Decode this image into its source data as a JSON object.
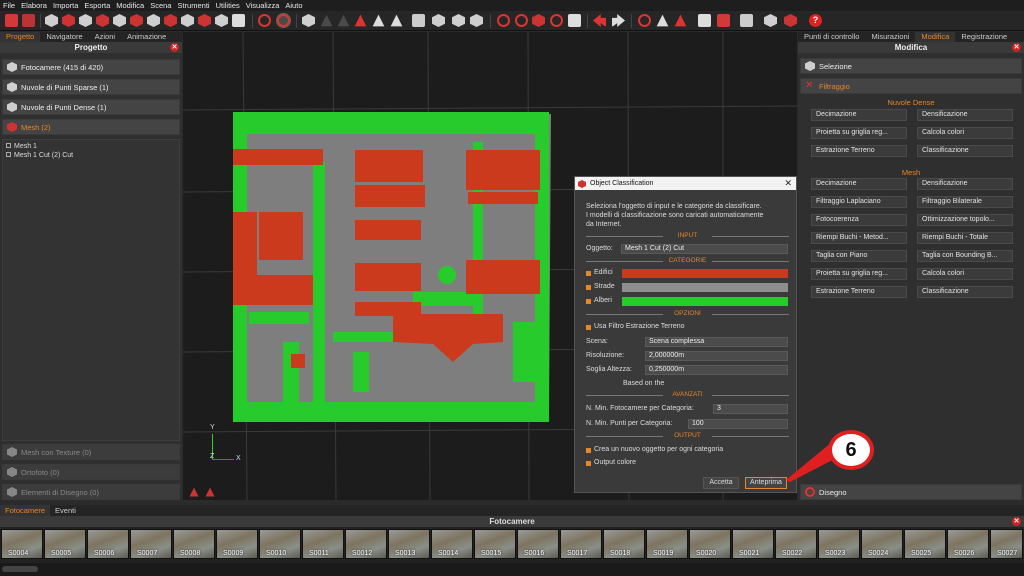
{
  "menu": [
    "File",
    "Elabora",
    "Importa",
    "Esporta",
    "Modifica",
    "Scena",
    "Strumenti",
    "Utilities",
    "Visualizza",
    "Aiuto"
  ],
  "left_panel": {
    "tabs": [
      "Progetto",
      "Navigatore",
      "Azioni",
      "Animazione"
    ],
    "title": "Progetto",
    "groups": [
      "Fotocamere (415 di 420)",
      "Nuvole di Punti Sparse (1)",
      "Nuvole di Punti Dense (1)",
      "Mesh (2)"
    ],
    "tree": [
      "Mesh 1",
      "Mesh 1 Cut (2) Cut"
    ],
    "bottom_groups": [
      "Mesh con Texture (0)",
      "Ortofoto (0)",
      "Elementi di Disegno (0)"
    ]
  },
  "right_panel": {
    "tabs": [
      "Punti di controllo",
      "Misurazioni",
      "Modifica",
      "Registrazione"
    ],
    "title": "Modifica",
    "selezione": "Selezione",
    "filtraggio": "Filtraggio",
    "nuvole_dense_header": "Nuvole Dense",
    "nuvole_dense_buttons": [
      "Decimazione",
      "Densificazione",
      "Proietta su griglia reg...",
      "Calcola colori",
      "Estrazione Terreno",
      "Classificazione"
    ],
    "mesh_header": "Mesh",
    "mesh_buttons": [
      "Decimazione",
      "Densificazione",
      "Filtraggio Laplaciano",
      "Filtraggio Bilaterale",
      "Fotocoerenza",
      "Ottimizzazione topolo...",
      "Riempi Buchi - Metod...",
      "Riempi Buchi - Totale",
      "Taglia con Piano",
      "Taglia con Bounding B...",
      "Proietta su griglia reg...",
      "Calcola colori",
      "Estrazione Terreno",
      "Classificazione"
    ],
    "disegno": "Disegno"
  },
  "dialog": {
    "title": "Object Classification",
    "intro": [
      "Seleziona l'oggetto di input e le categorie da classificare.",
      "I modelli di classificazione sono caricati automaticamente",
      "da Internet."
    ],
    "sec_input": "INPUT",
    "oggetto_label": "Oggetto:",
    "oggetto_value": "Mesh 1 Cut (2) Cut",
    "sec_categorie": "CATEGORIE",
    "categories": [
      {
        "name": "Edifici",
        "color": "#cc3a1e"
      },
      {
        "name": "Strade",
        "color": "#8e8e8e"
      },
      {
        "name": "Alberi",
        "color": "#27cc2c"
      }
    ],
    "sec_opzioni": "OPZIONI",
    "usa_filtro": "Usa Filtro Estrazione Terreno",
    "scena_label": "Scena:",
    "scena_value": "Scena complessa",
    "risoluzione_label": "Risoluzione:",
    "risoluzione_value": "2,000000m",
    "soglia_label": "Soglia Altezza:",
    "soglia_value": "0,250000m",
    "based_on": "Based on the",
    "sec_avanzati": "AVANZATI",
    "min_foto_label": "N. Min. Fotocamere per Categoria:",
    "min_foto_value": "3",
    "min_punti_label": "N. Min. Punti per Categoria:",
    "min_punti_value": "100",
    "sec_output": "OUTPUT",
    "crea_oggetto": "Crea un nuovo oggetto per ogni categoria",
    "output_colore": "Output colore",
    "accetta": "Accetta",
    "anteprima": "Anteprima"
  },
  "callout": "6",
  "axes": {
    "y": "Y",
    "x": "X",
    "z": "Z"
  },
  "bottom": {
    "tabs": [
      "Fotocamere",
      "Eventi"
    ],
    "title": "Fotocamere",
    "thumbs": [
      "S0004",
      "S0005",
      "S0006",
      "S0007",
      "S0008",
      "S0009",
      "S0010",
      "S0011",
      "S0012",
      "S0013",
      "S0014",
      "S0015",
      "S0016",
      "S0017",
      "S0018",
      "S0019",
      "S0020",
      "S0021",
      "S0022",
      "S0023",
      "S0024",
      "S0025",
      "S0026",
      "S0027"
    ]
  },
  "colors": {
    "accent": "#e8862a",
    "buildings": "#cc3a1e",
    "roads": "#8e8e8e",
    "trees": "#27cc2c"
  }
}
